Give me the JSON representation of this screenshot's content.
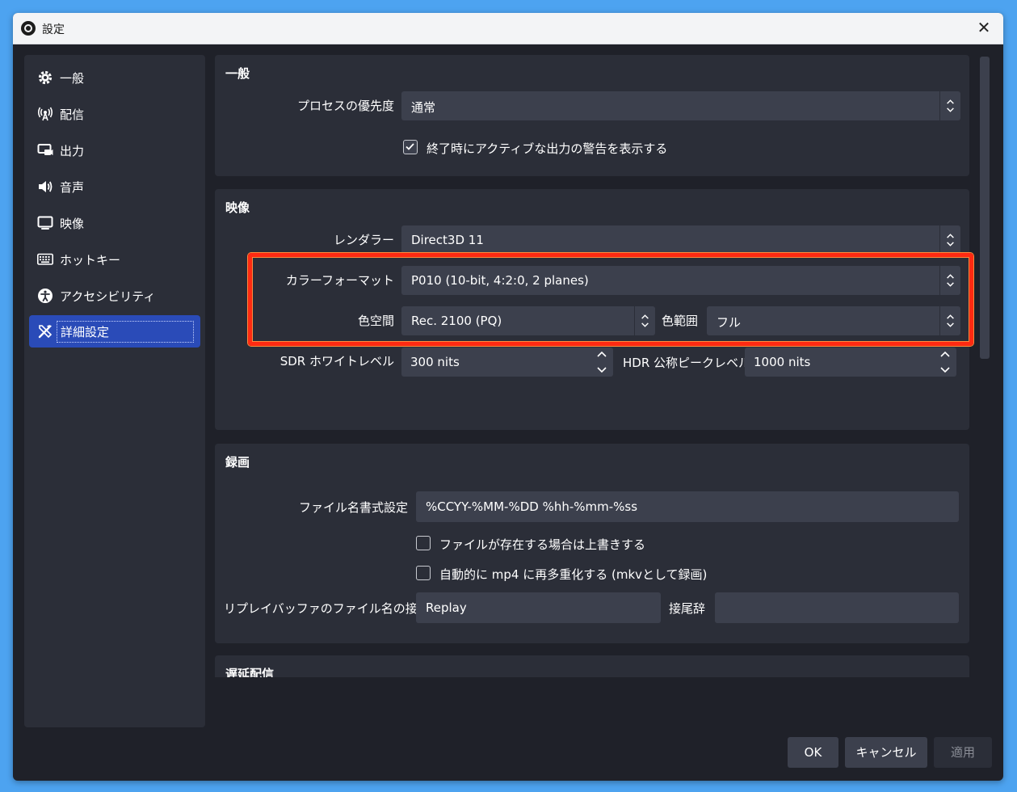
{
  "window": {
    "title": "設定",
    "close_glyph": "✕"
  },
  "sidebar": {
    "items": [
      {
        "label": "一般",
        "icon": "gear-icon"
      },
      {
        "label": "配信",
        "icon": "antenna-icon"
      },
      {
        "label": "出力",
        "icon": "output-icon"
      },
      {
        "label": "音声",
        "icon": "speaker-icon"
      },
      {
        "label": "映像",
        "icon": "monitor-icon"
      },
      {
        "label": "ホットキー",
        "icon": "keyboard-icon"
      },
      {
        "label": "アクセシビリティ",
        "icon": "accessibility-icon"
      },
      {
        "label": "詳細設定",
        "icon": "tools-icon",
        "active": true
      }
    ]
  },
  "general": {
    "title": "一般",
    "priority_label": "プロセスの優先度",
    "priority_value": "通常",
    "warn_label": "終了時にアクティブな出力の警告を表示する",
    "warn_checked": true
  },
  "video": {
    "title": "映像",
    "renderer_label": "レンダラー",
    "renderer_value": "Direct3D 11",
    "color_format_label": "カラーフォーマット",
    "color_format_value": "P010 (10-bit, 4:2:0, 2 planes)",
    "color_space_label": "色空間",
    "color_space_value": "Rec. 2100 (PQ)",
    "color_range_label": "色範囲",
    "color_range_value": "フル",
    "sdr_label": "SDR ホワイトレベル",
    "sdr_value": "300 nits",
    "hdr_label": "HDR 公称ピークレベル",
    "hdr_value": "1000 nits"
  },
  "recording": {
    "title": "録画",
    "filename_label": "ファイル名書式設定",
    "filename_value": "%CCYY-%MM-%DD %hh-%mm-%ss",
    "overwrite_label": "ファイルが存在する場合は上書きする",
    "overwrite_checked": false,
    "remux_label": "自動的に mp4 に再多重化する (mkvとして録画)",
    "remux_checked": false,
    "replay_prefix_label": "リプレイバッファのファイル名の接頭辞",
    "replay_prefix_value": "Replay",
    "suffix_label": "接尾辞",
    "suffix_value": ""
  },
  "delay": {
    "title": "遅延配信"
  },
  "footer": {
    "ok": "OK",
    "cancel": "キャンセル",
    "apply": "適用"
  },
  "colors": {
    "highlight": "#ff2a12",
    "active_nav": "#2a4bb8",
    "panel": "#2b2e38",
    "field": "#3c404d"
  }
}
